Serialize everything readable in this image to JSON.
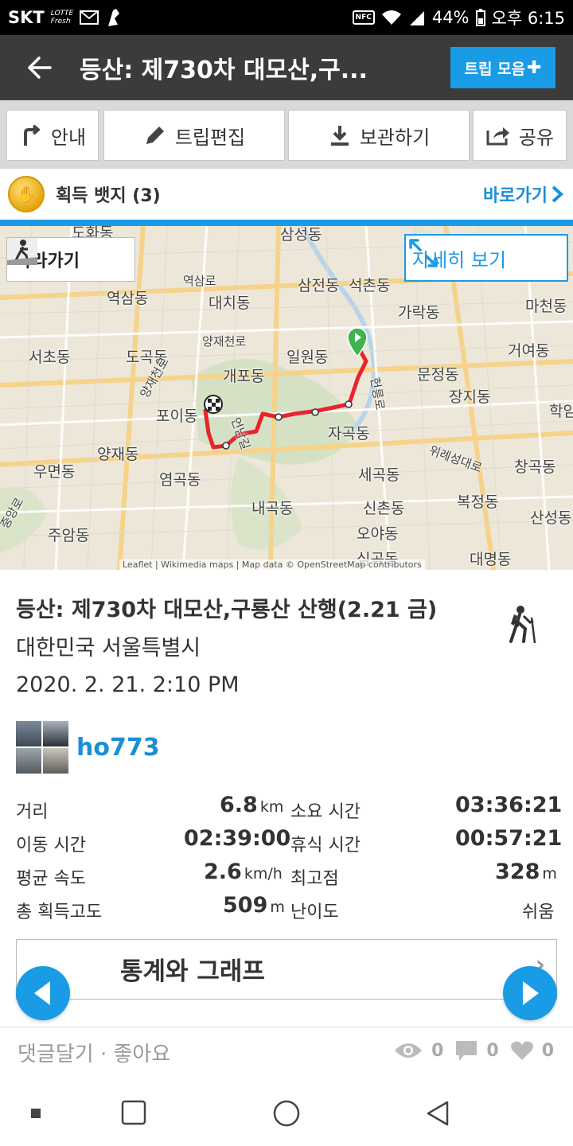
{
  "status_bar": {
    "carrier": "SKT",
    "lotte": "LOTTE",
    "fresh": "Fresh",
    "nfc": "NFC",
    "battery": "44%",
    "time": "오후 6:15"
  },
  "app_bar": {
    "title": "등산: 제730차 대모산,구...",
    "trip_collection": "트립 모음"
  },
  "actions": {
    "guide": "안내",
    "edit": "트립편집",
    "save": "보관하기",
    "share": "공유"
  },
  "badges": {
    "label": "획득 뱃지 (3)",
    "shortcut": "바로가기"
  },
  "map": {
    "follow": "따라가기",
    "detail": "자세히 보기",
    "attribution": "Leaflet | Wikimedia maps | Map data © OpenStreetMap contributors",
    "places": {
      "dohwa": "도화동",
      "samseong": "삼성동",
      "yeoksam": "역삼동",
      "yeoksamro": "역삼로",
      "daechi": "대치동",
      "samjeon": "삼전동",
      "seokchon": "석촌동",
      "garak": "가락동",
      "macheon": "마천동",
      "seocho": "서초동",
      "dogok": "도곡동",
      "yangjaecheon": "양재천로",
      "ilwon": "일원동",
      "geoyeo": "거여동",
      "munjeong": "문정동",
      "gaepo": "개포동",
      "yangjaecheonro2": "양재천로",
      "jangji": "장지동",
      "poi": "포이동",
      "hak": "학암",
      "jagok": "자곡동",
      "yangjae": "양재동",
      "umyeon": "우면동",
      "wirye": "위례성대로",
      "changgok": "창곡동",
      "yeomgok": "염곡동",
      "segok": "세곡동",
      "bokjeong": "복정동",
      "naegok": "내곡동",
      "sinchon": "신촌동",
      "sanseong": "산성동",
      "jungang": "중앙로",
      "juam": "주암동",
      "oya": "오야동",
      "simgok": "심곡동",
      "daemyeong": "대명동",
      "heollung": "헌릉로",
      "eollyeong": "언남길"
    }
  },
  "trip": {
    "title": "등산: 제730차 대모산,구룡산 산행(2.21 금)",
    "location": "대한민국 서울특별시",
    "date": "2020. 2. 21. 2:10 PM",
    "user": "ho773"
  },
  "stats": {
    "distance_label": "거리",
    "distance": "6.8",
    "distance_unit": "km",
    "duration_label": "소요 시간",
    "duration": "03:36:21",
    "moving_label": "이동 시간",
    "moving": "02:39:00",
    "rest_label": "휴식 시간",
    "rest": "00:57:21",
    "speed_label": "평균 속도",
    "speed": "2.6",
    "speed_unit": "km/h",
    "max_label": "최고점",
    "max": "328",
    "max_unit": "m",
    "gain_label": "총 획득고도",
    "gain": "509",
    "gain_unit": "m",
    "difficulty_label": "난이도",
    "difficulty": "쉬움"
  },
  "graphs": {
    "label": "통계와 그래프"
  },
  "footer": {
    "comment_like": "댓글달기 · 좋아요",
    "views": "0",
    "comments": "0",
    "likes": "0"
  },
  "colors": {
    "accent": "#1a9be6",
    "app_bar": "#3b3b3b",
    "route": "#e8232a",
    "start": "#3fb34f"
  }
}
